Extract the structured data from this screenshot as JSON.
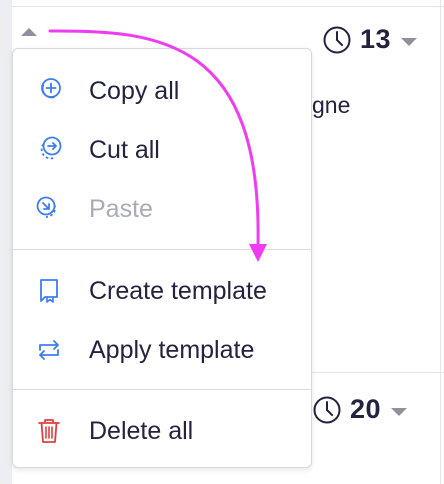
{
  "colors": {
    "text": "#23233f",
    "muted": "#a8acb6",
    "icon_blue": "#3d7df2",
    "icon_red": "#e0413f",
    "arrow": "#f03cf0"
  },
  "background": {
    "top_time": "13",
    "bottom_time": "20",
    "partial_text": "gne"
  },
  "menu": {
    "items": [
      {
        "label": "Copy all",
        "icon": "copy-plus-icon",
        "enabled": true
      },
      {
        "label": "Cut all",
        "icon": "cut-icon",
        "enabled": true
      },
      {
        "label": "Paste",
        "icon": "paste-icon",
        "enabled": false
      },
      {
        "label": "Create template",
        "icon": "bookmark-icon",
        "enabled": true
      },
      {
        "label": "Apply template",
        "icon": "swap-arrows-icon",
        "enabled": true
      },
      {
        "label": "Delete all",
        "icon": "trash-icon",
        "enabled": true
      }
    ]
  }
}
